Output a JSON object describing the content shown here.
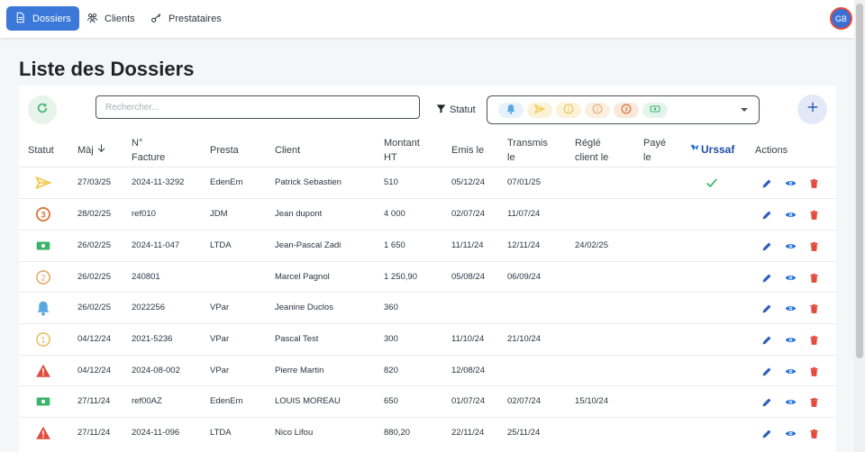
{
  "nav": [
    {
      "label": "Dossiers",
      "icon": "document-icon"
    },
    {
      "label": "Clients",
      "icon": "users-icon"
    },
    {
      "label": "Prestataires",
      "icon": "key-icon"
    }
  ],
  "user": {
    "initials": "GB"
  },
  "page": {
    "title": "Liste des Dossiers"
  },
  "search": {
    "placeholder": "Rechercher..."
  },
  "filter": {
    "label": "Statut",
    "chips": [
      "bell-icon",
      "send-icon",
      "step-1-icon",
      "step-2-icon",
      "step-3-icon",
      "money-icon"
    ]
  },
  "table": {
    "headers": {
      "statut": "Statut",
      "maj": "Màj",
      "facture_l1": "N°",
      "facture_l2": "Facture",
      "presta": "Presta",
      "client": "Client",
      "montant_l1": "Montant",
      "montant_l2": "HT",
      "emis": "Emis le",
      "transmis_l1": "Transmis",
      "transmis_l2": "le",
      "regle_l1": "Réglé",
      "regle_l2": "client le",
      "paye_l1": "Payé",
      "paye_l2": "le",
      "urssaf": "Urssaf",
      "actions": "Actions"
    },
    "rows": [
      {
        "status": "send",
        "maj": "27/03/25",
        "facture": "2024-11-3292",
        "presta": "EdenEm",
        "client": "Patrick Sebastien",
        "montant": "510",
        "emis": "05/12/24",
        "transmis": "07/01/25",
        "regle": "",
        "paye": "",
        "urssaf": true
      },
      {
        "status": "step3",
        "maj": "28/02/25",
        "facture": "ref010",
        "presta": "JDM",
        "client": "Jean dupont",
        "montant": "4 000",
        "emis": "02/07/24",
        "transmis": "11/07/24",
        "regle": "",
        "paye": "",
        "urssaf": false
      },
      {
        "status": "money",
        "maj": "26/02/25",
        "facture": "2024-11-047",
        "presta": "LTDA",
        "client": "Jean-Pascal Zadi",
        "montant": "1 650",
        "emis": "11/11/24",
        "transmis": "12/11/24",
        "regle": "24/02/25",
        "paye": "",
        "urssaf": false
      },
      {
        "status": "step2",
        "maj": "26/02/25",
        "facture": "240801",
        "presta": "",
        "client": "Marcel Pagnol",
        "montant": "1 250,90",
        "emis": "05/08/24",
        "transmis": "06/09/24",
        "regle": "",
        "paye": "",
        "urssaf": false
      },
      {
        "status": "bell",
        "maj": "26/02/25",
        "facture": "2022256",
        "presta": "VPar",
        "client": "Jeanine Duclos",
        "montant": "360",
        "emis": "",
        "transmis": "",
        "regle": "",
        "paye": "",
        "urssaf": false
      },
      {
        "status": "step1",
        "maj": "04/12/24",
        "facture": "2021-5236",
        "presta": "VPar",
        "client": "Pascal Test",
        "montant": "300",
        "emis": "11/10/24",
        "transmis": "21/10/24",
        "regle": "",
        "paye": "",
        "urssaf": false
      },
      {
        "status": "warning",
        "maj": "04/12/24",
        "facture": "2024-08-002",
        "presta": "VPar",
        "client": "Pierre Martin",
        "montant": "820",
        "emis": "12/08/24",
        "transmis": "",
        "regle": "",
        "paye": "",
        "urssaf": false
      },
      {
        "status": "money",
        "maj": "27/11/24",
        "facture": "ref00AZ",
        "presta": "EdenEm",
        "client": "LOUIS MOREAU",
        "montant": "650",
        "emis": "01/07/24",
        "transmis": "02/07/24",
        "regle": "15/10/24",
        "paye": "",
        "urssaf": false
      },
      {
        "status": "warning",
        "maj": "27/11/24",
        "facture": "2024-11-096",
        "presta": "LTDA",
        "client": "Nico Lifou",
        "montant": "880,20",
        "emis": "22/11/24",
        "transmis": "25/11/24",
        "regle": "",
        "paye": "",
        "urssaf": false
      }
    ]
  },
  "colors": {
    "primary": "#3b78d8",
    "send": "#f2c53d",
    "step": "#e0a96d",
    "step3": "#d9733a",
    "money": "#3bb36b",
    "bell": "#5aa7e0",
    "warning": "#e24b3d",
    "edit": "#2e5fb8",
    "view": "#1e6fd9",
    "delete": "#e24b3d"
  }
}
